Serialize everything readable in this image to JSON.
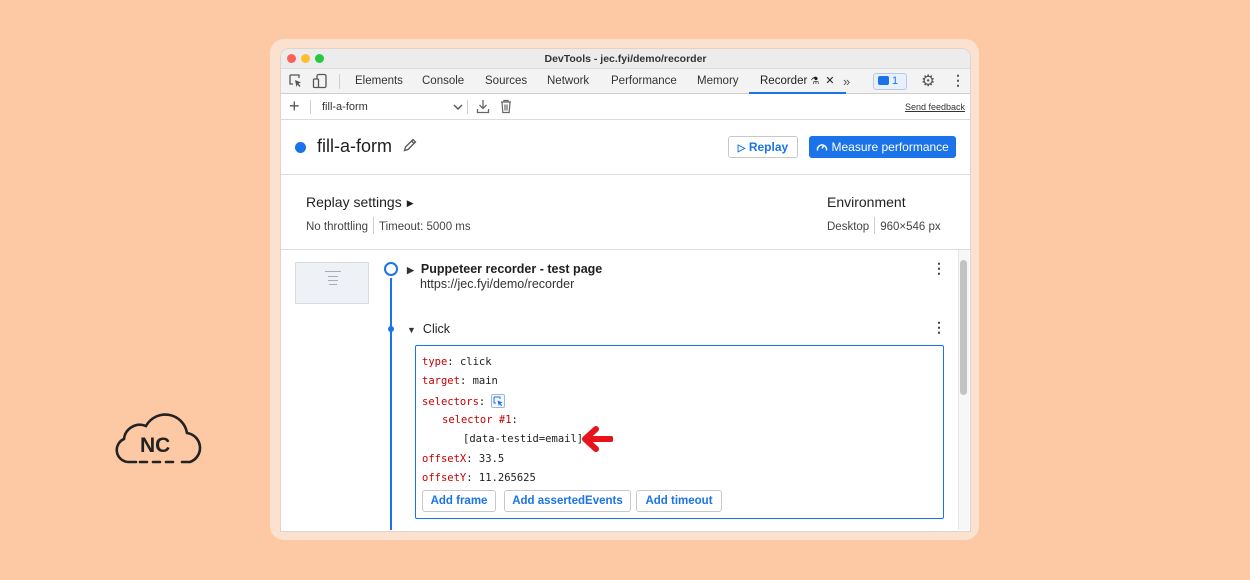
{
  "window": {
    "title": "DevTools - jec.fyi/demo/recorder"
  },
  "tabs": [
    {
      "label": "Elements"
    },
    {
      "label": "Console"
    },
    {
      "label": "Sources"
    },
    {
      "label": "Network"
    },
    {
      "label": "Performance"
    },
    {
      "label": "Memory"
    },
    {
      "label": "Recorder",
      "active": true
    }
  ],
  "toolbar": {
    "issues_count": "1"
  },
  "recorder_bar": {
    "recording_name": "fill-a-form",
    "feedback_label": "Send feedback"
  },
  "header": {
    "title": "fill-a-form",
    "replay_label": "Replay",
    "measure_label": "Measure performance"
  },
  "settings": {
    "title": "Replay settings",
    "throttling": "No throttling",
    "timeout": "Timeout: 5000 ms",
    "env_title": "Environment",
    "device": "Desktop",
    "viewport": "960×546 px"
  },
  "steps": [
    {
      "title": "Puppeteer recorder - test page",
      "url": "https://jec.fyi/demo/recorder"
    },
    {
      "title": "Click"
    }
  ],
  "step_details": {
    "type_key": "type",
    "type_val": "click",
    "target_key": "target",
    "target_val": "main",
    "selectors_key": "selectors",
    "selector_key": "selector #1",
    "selector_val": "[data-testid=email]",
    "offsetx_key": "offsetX",
    "offsetx_val": "33.5",
    "offsety_key": "offsetY",
    "offsety_val": "11.265625"
  },
  "actions": {
    "add_frame": "Add frame",
    "add_asserted": "Add assertedEvents",
    "add_timeout": "Add timeout"
  },
  "logo": {
    "text": "NC"
  },
  "colors": {
    "accent": "#1a73e8",
    "background": "#fdc9a4",
    "arrow": "#e8141b",
    "code_key": "#c80000"
  }
}
